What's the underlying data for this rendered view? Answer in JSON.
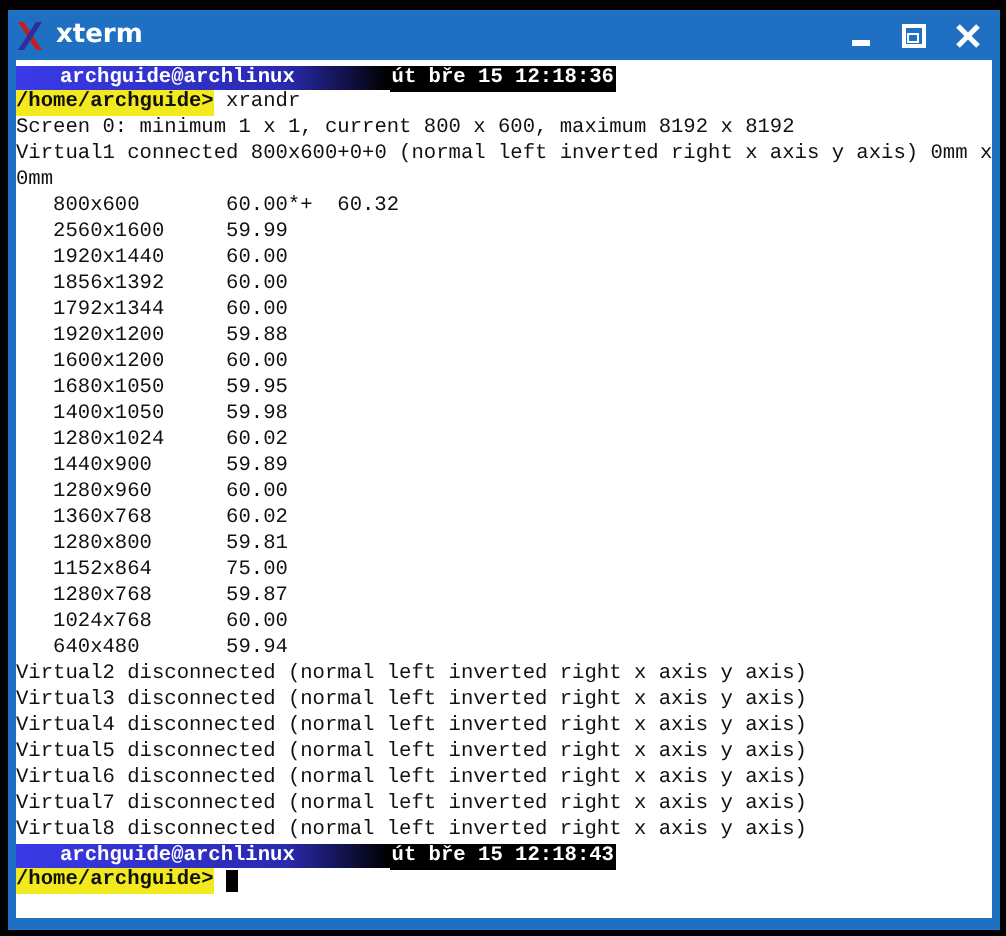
{
  "window": {
    "title": "xterm"
  },
  "terminal": {
    "blocks": [
      {
        "kind": "status",
        "user_host": "archguide@archlinux",
        "datetime": "út bře 15 12:18:36"
      },
      {
        "kind": "prompt",
        "path": "/home/archguide>",
        "command": "xrandr",
        "cursor": false
      },
      {
        "kind": "line",
        "text": "Screen 0: minimum 1 x 1, current 800 x 600, maximum 8192 x 8192"
      },
      {
        "kind": "line",
        "text": "Virtual1 connected 800x600+0+0 (normal left inverted right x axis y axis) 0mm x 0mm"
      },
      {
        "kind": "mode",
        "mode": "800x600",
        "rates": [
          "60.00*+",
          "60.32"
        ]
      },
      {
        "kind": "mode",
        "mode": "2560x1600",
        "rates": [
          "59.99"
        ]
      },
      {
        "kind": "mode",
        "mode": "1920x1440",
        "rates": [
          "60.00"
        ]
      },
      {
        "kind": "mode",
        "mode": "1856x1392",
        "rates": [
          "60.00"
        ]
      },
      {
        "kind": "mode",
        "mode": "1792x1344",
        "rates": [
          "60.00"
        ]
      },
      {
        "kind": "mode",
        "mode": "1920x1200",
        "rates": [
          "59.88"
        ]
      },
      {
        "kind": "mode",
        "mode": "1600x1200",
        "rates": [
          "60.00"
        ]
      },
      {
        "kind": "mode",
        "mode": "1680x1050",
        "rates": [
          "59.95"
        ]
      },
      {
        "kind": "mode",
        "mode": "1400x1050",
        "rates": [
          "59.98"
        ]
      },
      {
        "kind": "mode",
        "mode": "1280x1024",
        "rates": [
          "60.02"
        ]
      },
      {
        "kind": "mode",
        "mode": "1440x900",
        "rates": [
          "59.89"
        ]
      },
      {
        "kind": "mode",
        "mode": "1280x960",
        "rates": [
          "60.00"
        ]
      },
      {
        "kind": "mode",
        "mode": "1360x768",
        "rates": [
          "60.02"
        ]
      },
      {
        "kind": "mode",
        "mode": "1280x800",
        "rates": [
          "59.81"
        ]
      },
      {
        "kind": "mode",
        "mode": "1152x864",
        "rates": [
          "75.00"
        ]
      },
      {
        "kind": "mode",
        "mode": "1280x768",
        "rates": [
          "59.87"
        ]
      },
      {
        "kind": "mode",
        "mode": "1024x768",
        "rates": [
          "60.00"
        ]
      },
      {
        "kind": "mode",
        "mode": "640x480",
        "rates": [
          "59.94"
        ]
      },
      {
        "kind": "line",
        "text": "Virtual2 disconnected (normal left inverted right x axis y axis)"
      },
      {
        "kind": "line",
        "text": "Virtual3 disconnected (normal left inverted right x axis y axis)"
      },
      {
        "kind": "line",
        "text": "Virtual4 disconnected (normal left inverted right x axis y axis)"
      },
      {
        "kind": "line",
        "text": "Virtual5 disconnected (normal left inverted right x axis y axis)"
      },
      {
        "kind": "line",
        "text": "Virtual6 disconnected (normal left inverted right x axis y axis)"
      },
      {
        "kind": "line",
        "text": "Virtual7 disconnected (normal left inverted right x axis y axis)"
      },
      {
        "kind": "line",
        "text": "Virtual8 disconnected (normal left inverted right x axis y axis)"
      },
      {
        "kind": "status",
        "user_host": "archguide@archlinux",
        "datetime": "út bře 15 12:18:43"
      },
      {
        "kind": "prompt",
        "path": "/home/archguide>",
        "cursor": true
      }
    ]
  }
}
